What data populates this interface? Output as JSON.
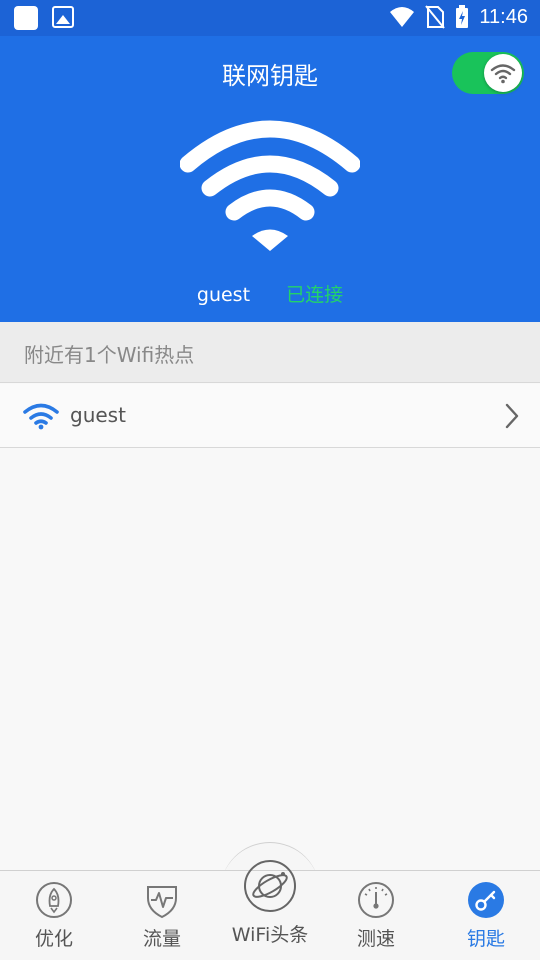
{
  "status_bar": {
    "time": "11:46"
  },
  "header": {
    "title": "联网钥匙",
    "toggle_on": true,
    "connected_ssid": "guest",
    "connection_status": "已连接"
  },
  "nearby": {
    "summary": "附近有1个Wifi热点",
    "networks": [
      {
        "name": "guest"
      }
    ]
  },
  "bottom_nav": {
    "items": [
      {
        "label": "优化",
        "icon": "rocket-icon"
      },
      {
        "label": "流量",
        "icon": "pulse-shield-icon"
      },
      {
        "label": "WiFi头条",
        "icon": "planet-icon"
      },
      {
        "label": "测速",
        "icon": "speedometer-icon"
      },
      {
        "label": "钥匙",
        "icon": "key-icon"
      }
    ],
    "active_index": 4
  },
  "colors": {
    "header_blue": "#1f6fe5",
    "status_bar_blue": "#1c63d6",
    "toggle_green": "#19c35a",
    "connected_green": "#22d36a",
    "active_tab_blue": "#2a7ae4"
  }
}
